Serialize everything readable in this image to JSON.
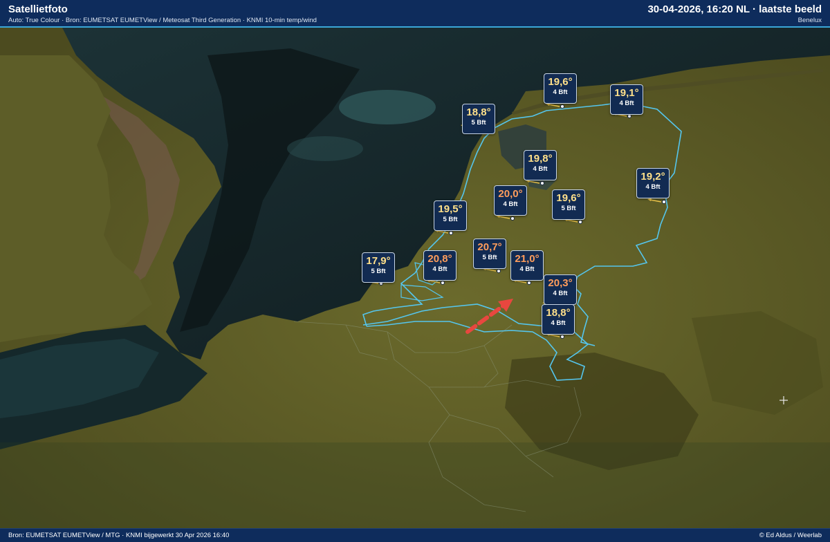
{
  "header": {
    "title": "Satellietfoto",
    "subtitle": "Auto: True Colour · Bron: EUMETSAT EUMETView / Meteosat Third Generation · KNMI 10-min temp/wind",
    "timestamp": "30-04-2026, 16:20 NL · laatste beeld",
    "region": "Benelux"
  },
  "footer": {
    "source": "Bron: EUMETSAT EUMETView / MTG · KNMI bijgewerkt 30 Apr 2026 16:40",
    "credit": "© Ed Aldus / Weerlab"
  },
  "colors": {
    "header_bg": "#0e2c5c",
    "border_line": "#55c6ee",
    "label_bg": "#122b52",
    "temp_cool": "#ffe08a",
    "temp_warm": "#ff9d5c",
    "wind_arrow": "#f2c94c",
    "pointer_arrow": "#e8473f"
  },
  "stations": [
    {
      "temp": "19,6°",
      "wind": "4 Bft",
      "warm": false
    },
    {
      "temp": "19,1°",
      "wind": "4 Bft",
      "warm": false
    },
    {
      "temp": "18,8°",
      "wind": "5 Bft",
      "warm": false
    },
    {
      "temp": "19,8°",
      "wind": "4 Bft",
      "warm": false
    },
    {
      "temp": "19,2°",
      "wind": "4 Bft",
      "warm": false
    },
    {
      "temp": "20,0°",
      "wind": "4 Bft",
      "warm": true
    },
    {
      "temp": "19,6°",
      "wind": "5 Bft",
      "warm": false
    },
    {
      "temp": "19,5°",
      "wind": "5 Bft",
      "warm": false
    },
    {
      "temp": "20,7°",
      "wind": "5 Bft",
      "warm": true
    },
    {
      "temp": "21,0°",
      "wind": "4 Bft",
      "warm": true
    },
    {
      "temp": "17,9°",
      "wind": "5 Bft",
      "warm": false
    },
    {
      "temp": "20,8°",
      "wind": "4 Bft",
      "warm": true
    },
    {
      "temp": "20,3°",
      "wind": "4 Bft",
      "warm": true
    },
    {
      "temp": "18,8°",
      "wind": "4 Bft",
      "warm": false
    }
  ],
  "icons": {
    "wind": "wind-direction-arrow-icon",
    "dot": "station-dot-icon",
    "pointer": "pointer-arrow-icon",
    "crosshair": "crosshair-icon"
  }
}
